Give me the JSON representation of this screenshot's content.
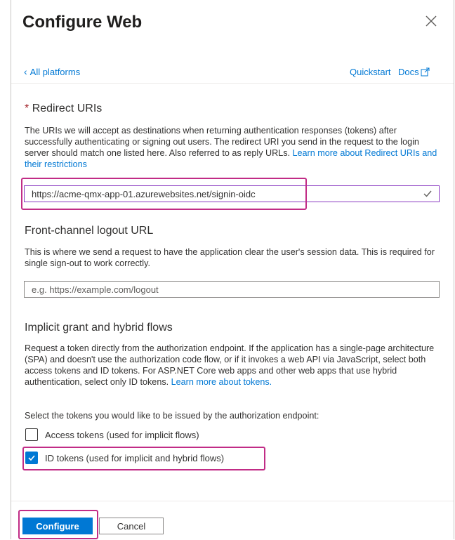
{
  "panel": {
    "title": "Configure Web"
  },
  "nav": {
    "back_label": "All platforms",
    "quickstart_label": "Quickstart",
    "docs_label": "Docs"
  },
  "redirect": {
    "required_marker": "*",
    "heading": "Redirect URIs",
    "description": "The URIs we will accept as destinations when returning authentication responses (tokens) after successfully authenticating or signing out users. The redirect URI you send in the request to the login server should match one listed here. Also referred to as reply URLs.",
    "link_text": "Learn more about Redirect URIs and their restrictions",
    "uri_value": "https://acme-qmx-app-01.azurewebsites.net/signin-oidc"
  },
  "logout": {
    "heading": "Front-channel logout URL",
    "description": "This is where we send a request to have the application clear the user's session data. This is required for single sign-out to work correctly.",
    "placeholder": "e.g. https://example.com/logout"
  },
  "implicit": {
    "heading": "Implicit grant and hybrid flows",
    "description": "Request a token directly from the authorization endpoint. If the application has a single-page architecture (SPA) and doesn't use the authorization code flow, or if it invokes a web API via JavaScript, select both access tokens and ID tokens. For ASP.NET Core web apps and other web apps that use hybrid authentication, select only ID tokens.",
    "link_text": "Learn more about tokens.",
    "select_prompt": "Select the tokens you would like to be issued by the authorization endpoint:",
    "options": [
      {
        "label": "Access tokens (used for implicit flows)",
        "checked": false
      },
      {
        "label": "ID tokens (used for implicit and hybrid flows)",
        "checked": true
      }
    ]
  },
  "footer": {
    "configure_label": "Configure",
    "cancel_label": "Cancel"
  },
  "colors": {
    "accent": "#0078d4",
    "highlight": "#c12c86",
    "required": "#a4262c"
  }
}
